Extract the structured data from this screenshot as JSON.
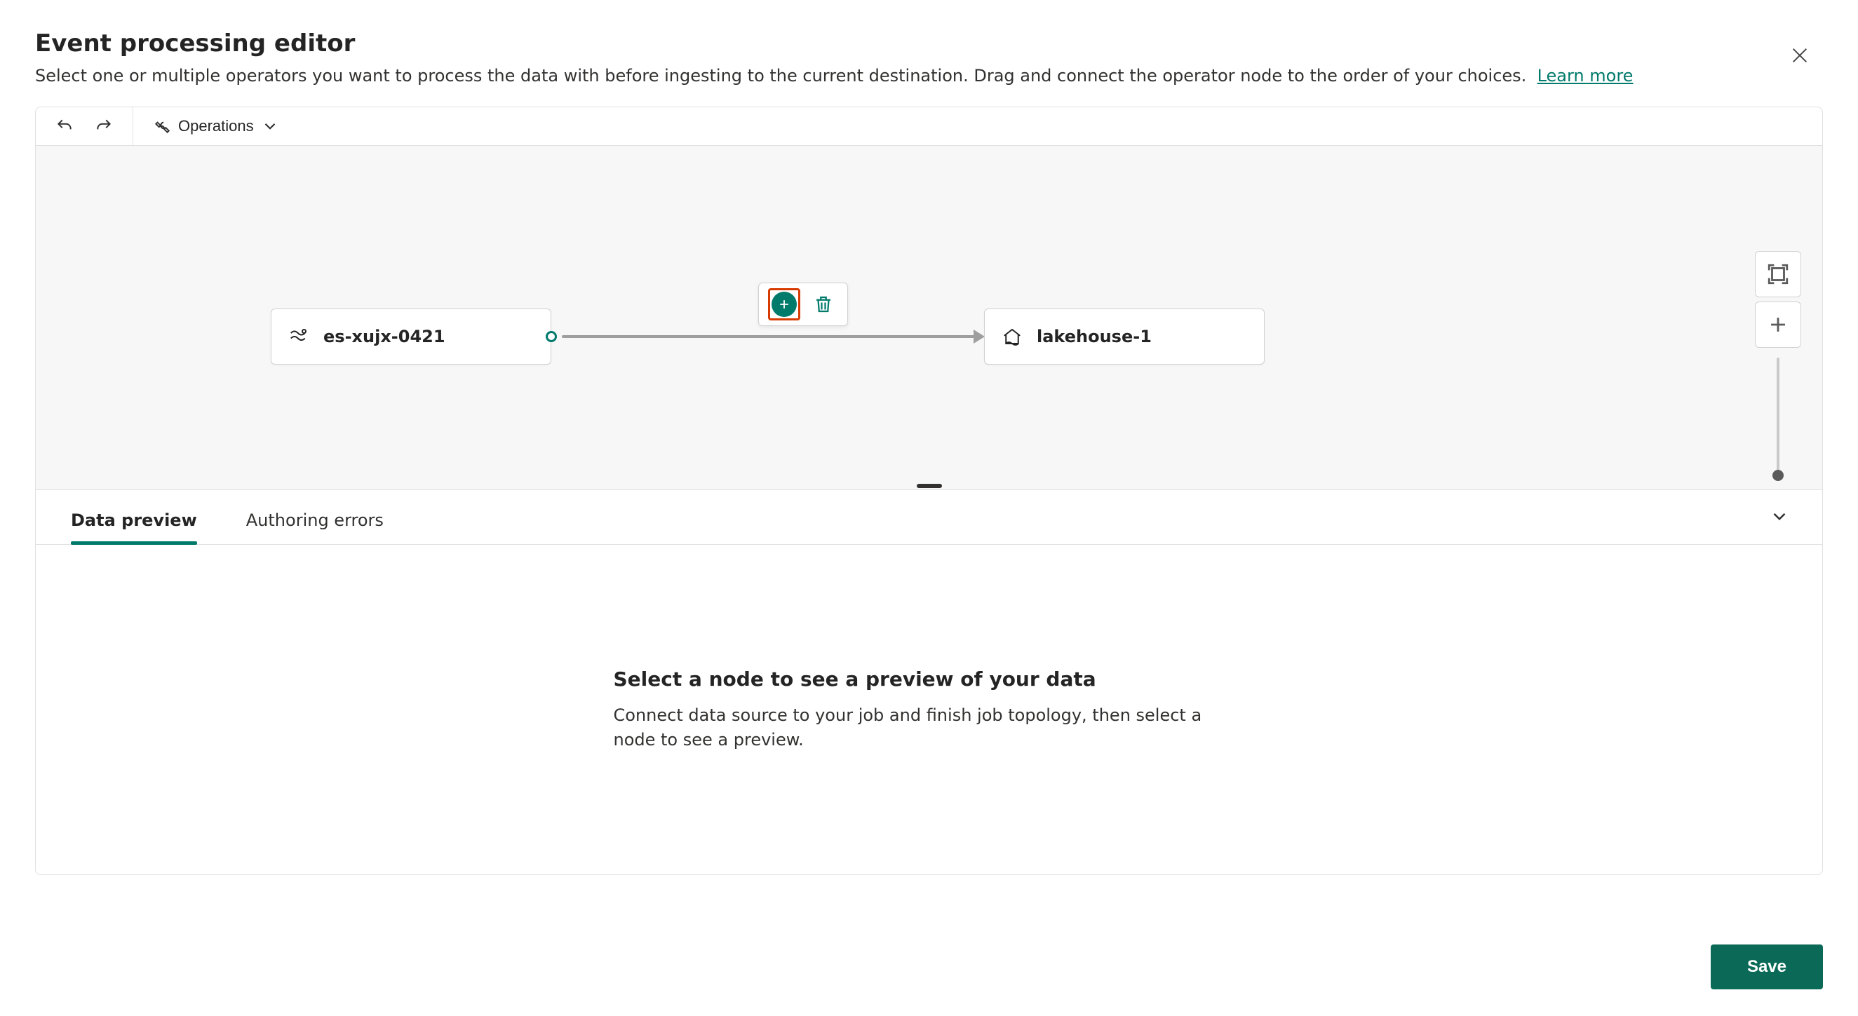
{
  "header": {
    "title": "Event processing editor",
    "subtitle": "Select one or multiple operators you want to process the data with before ingesting to the current destination. Drag and connect the operator node to the order of your choices.",
    "learn_more": "Learn more"
  },
  "toolbar": {
    "operations_label": "Operations"
  },
  "canvas": {
    "source_node": {
      "label": "es-xujx-0421"
    },
    "destination_node": {
      "label": "lakehouse-1"
    }
  },
  "bottom_panel": {
    "tabs": {
      "data_preview": "Data preview",
      "authoring_errors": "Authoring errors"
    },
    "placeholder": {
      "title": "Select a node to see a preview of your data",
      "subtitle": "Connect data source to your job and finish job topology, then select a node to see a preview."
    }
  },
  "footer": {
    "save": "Save"
  }
}
